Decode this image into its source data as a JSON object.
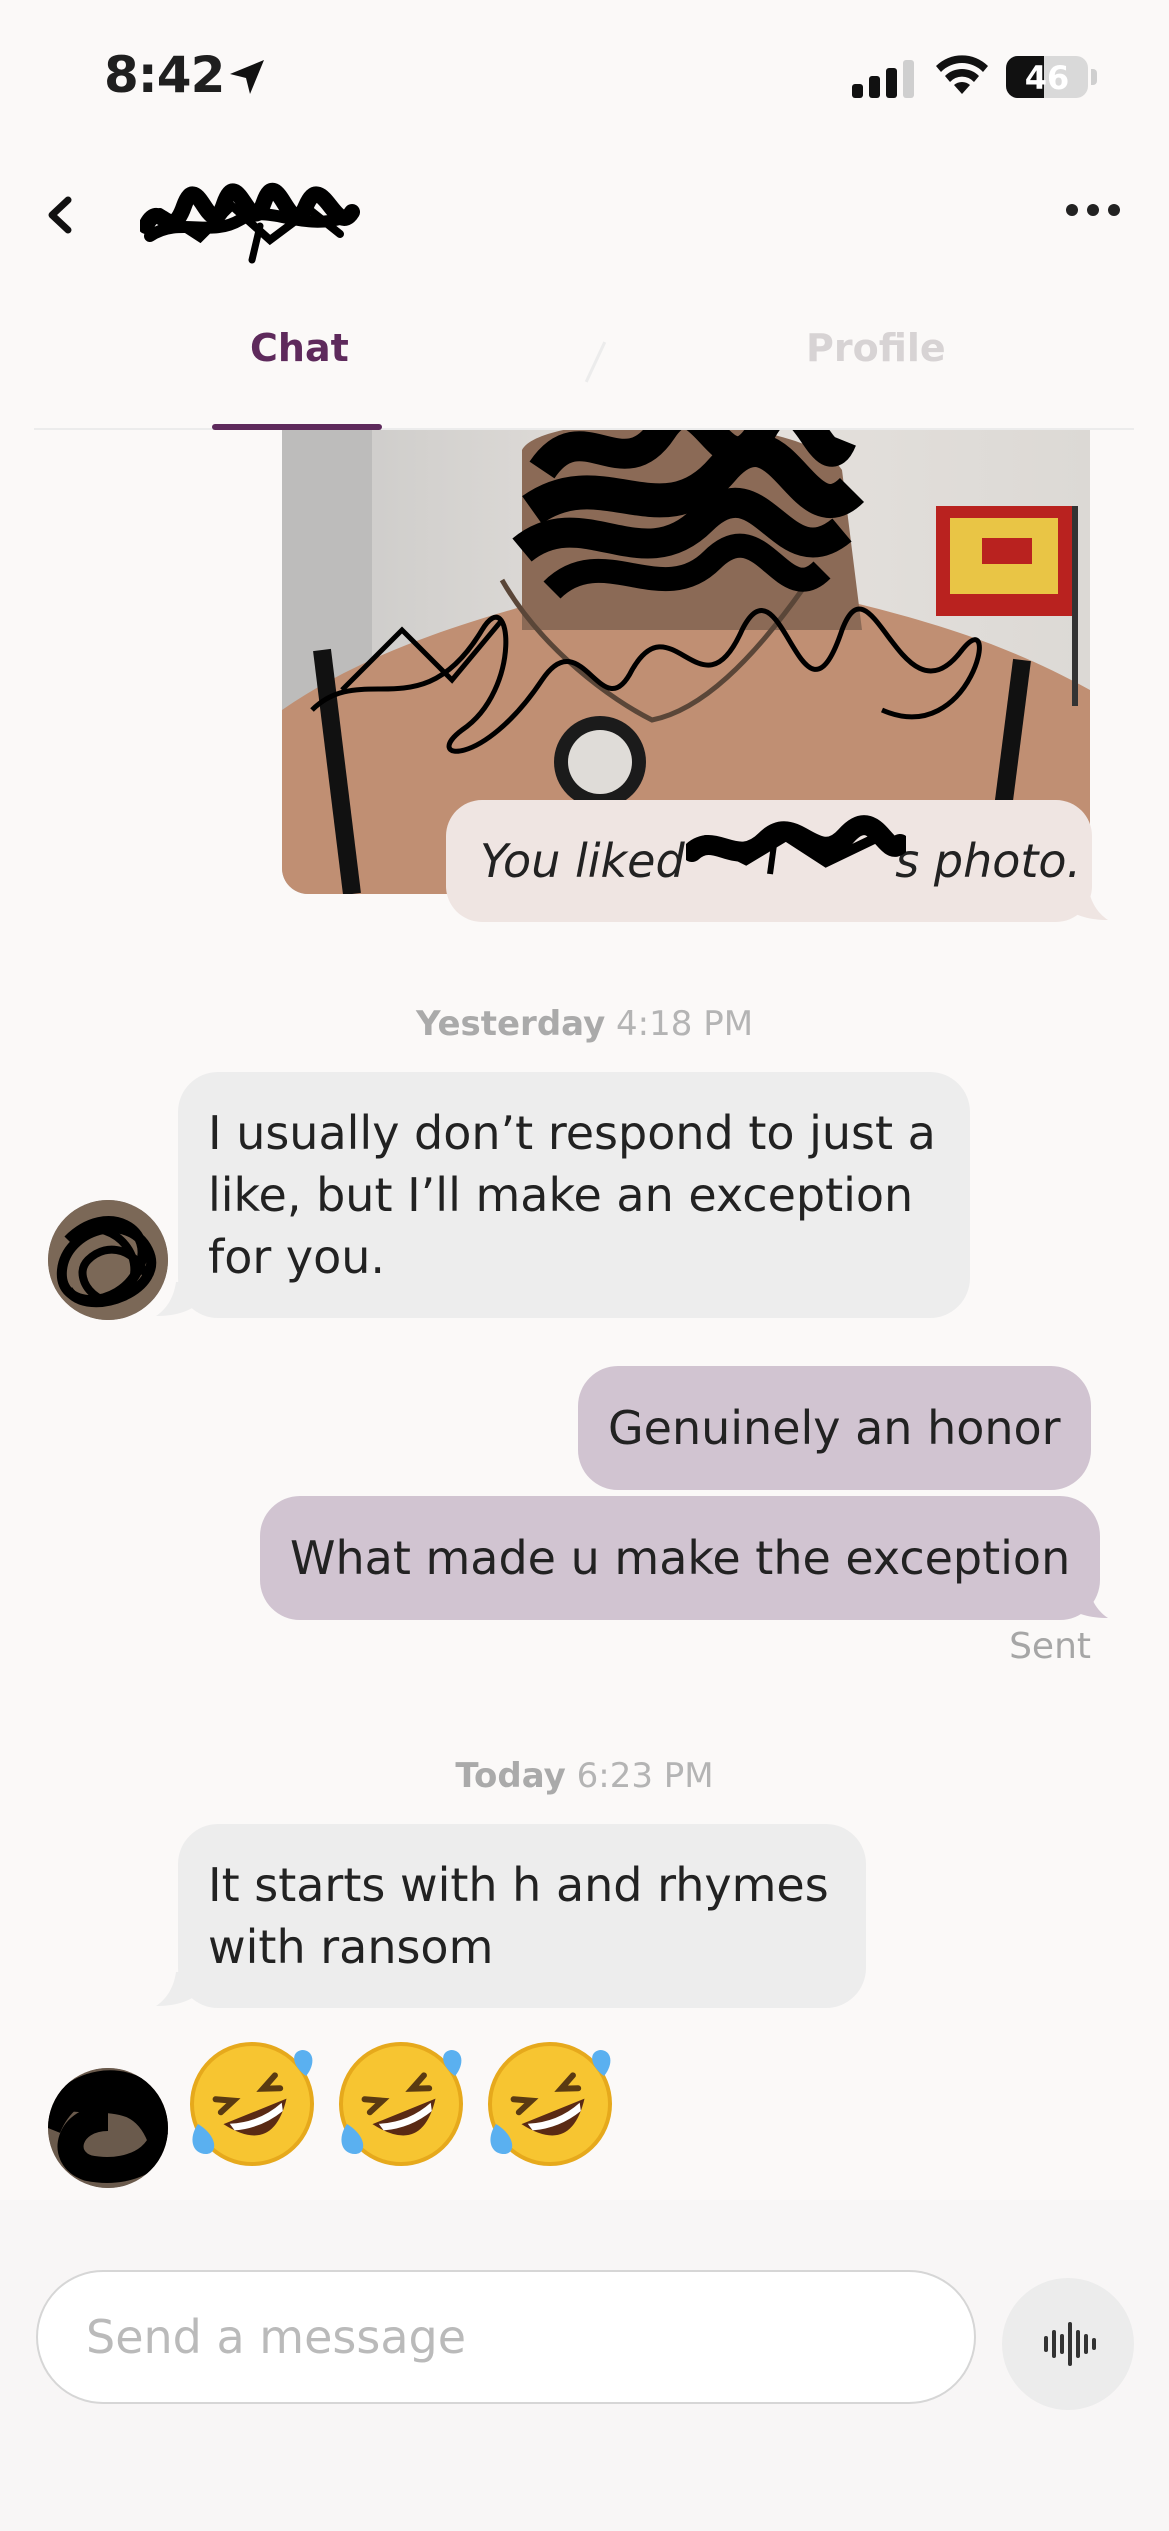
{
  "status_bar": {
    "time": "8:42",
    "battery": "46",
    "battery_level": 0.46
  },
  "header": {
    "back_icon": "chevron-left-icon",
    "more_icon": "more-horizontal-icon"
  },
  "tabs": [
    {
      "label": "Chat",
      "active": true
    },
    {
      "label": "Profile",
      "active": false
    }
  ],
  "liked_photo": {
    "text_prefix": "You liked ",
    "text_suffix": "s photo."
  },
  "timestamps": [
    {
      "day": "Yesterday",
      "time": "4:18 PM"
    },
    {
      "day": "Today",
      "time": "6:23 PM"
    }
  ],
  "messages": {
    "incoming_1": "I usually don’t respond to just a like, but I’ll make an exception for you.",
    "outgoing_1": "Genuinely an honor",
    "outgoing_2": "What made u make the exception",
    "sent_status": "Sent",
    "incoming_2": "It starts with h and rhymes with ransom",
    "emoji": [
      "🤣",
      "🤣",
      "🤣"
    ]
  },
  "composer": {
    "placeholder": "Send a message",
    "voice_icon": "waveform-icon"
  },
  "colors": {
    "accent": "#5e2a5c",
    "outgoing_bubble": "#d1c4d1",
    "incoming_bubble": "#ededed",
    "liked_bubble": "#efe5e2"
  }
}
